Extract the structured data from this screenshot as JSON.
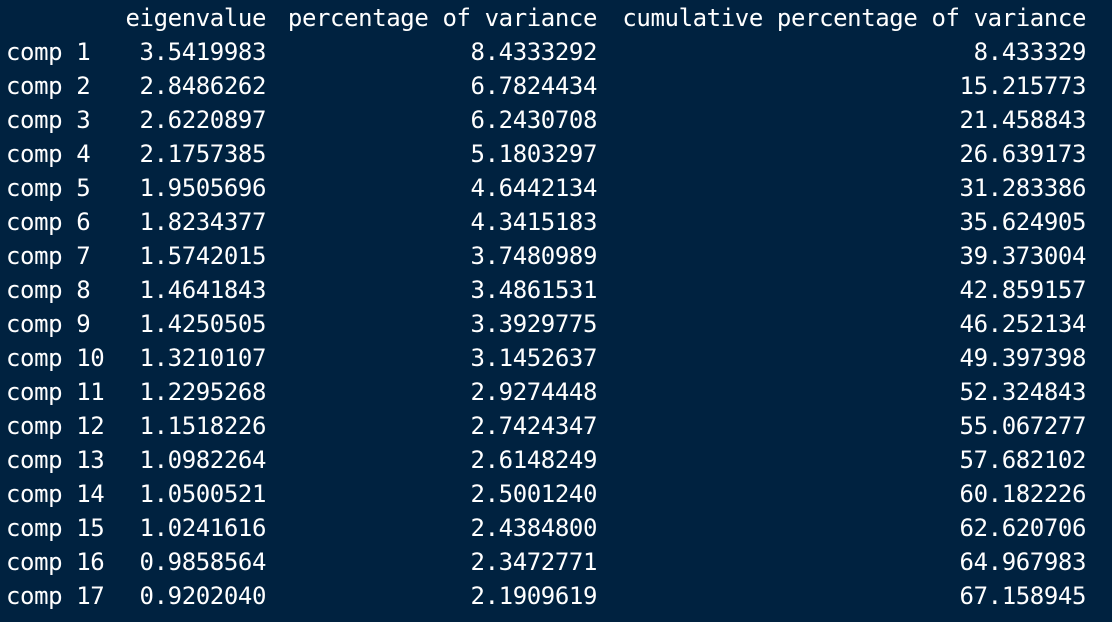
{
  "table": {
    "headers": [
      "eigenvalue",
      "percentage of variance",
      "cumulative percentage of variance"
    ],
    "rows": [
      {
        "label": "comp 1",
        "eigenvalue": "3.5419983",
        "pct": "8.4333292",
        "cum": "8.433329"
      },
      {
        "label": "comp 2",
        "eigenvalue": "2.8486262",
        "pct": "6.7824434",
        "cum": "15.215773"
      },
      {
        "label": "comp 3",
        "eigenvalue": "2.6220897",
        "pct": "6.2430708",
        "cum": "21.458843"
      },
      {
        "label": "comp 4",
        "eigenvalue": "2.1757385",
        "pct": "5.1803297",
        "cum": "26.639173"
      },
      {
        "label": "comp 5",
        "eigenvalue": "1.9505696",
        "pct": "4.6442134",
        "cum": "31.283386"
      },
      {
        "label": "comp 6",
        "eigenvalue": "1.8234377",
        "pct": "4.3415183",
        "cum": "35.624905"
      },
      {
        "label": "comp 7",
        "eigenvalue": "1.5742015",
        "pct": "3.7480989",
        "cum": "39.373004"
      },
      {
        "label": "comp 8",
        "eigenvalue": "1.4641843",
        "pct": "3.4861531",
        "cum": "42.859157"
      },
      {
        "label": "comp 9",
        "eigenvalue": "1.4250505",
        "pct": "3.3929775",
        "cum": "46.252134"
      },
      {
        "label": "comp 10",
        "eigenvalue": "1.3210107",
        "pct": "3.1452637",
        "cum": "49.397398"
      },
      {
        "label": "comp 11",
        "eigenvalue": "1.2295268",
        "pct": "2.9274448",
        "cum": "52.324843"
      },
      {
        "label": "comp 12",
        "eigenvalue": "1.1518226",
        "pct": "2.7424347",
        "cum": "55.067277"
      },
      {
        "label": "comp 13",
        "eigenvalue": "1.0982264",
        "pct": "2.6148249",
        "cum": "57.682102"
      },
      {
        "label": "comp 14",
        "eigenvalue": "1.0500521",
        "pct": "2.5001240",
        "cum": "60.182226"
      },
      {
        "label": "comp 15",
        "eigenvalue": "1.0241616",
        "pct": "2.4384800",
        "cum": "62.620706"
      },
      {
        "label": "comp 16",
        "eigenvalue": "0.9858564",
        "pct": "2.3472771",
        "cum": "64.967983"
      },
      {
        "label": "comp 17",
        "eigenvalue": "0.9202040",
        "pct": "2.1909619",
        "cum": "67.158945"
      }
    ]
  },
  "colors": {
    "background": "#002240",
    "text": "#ffffff"
  }
}
